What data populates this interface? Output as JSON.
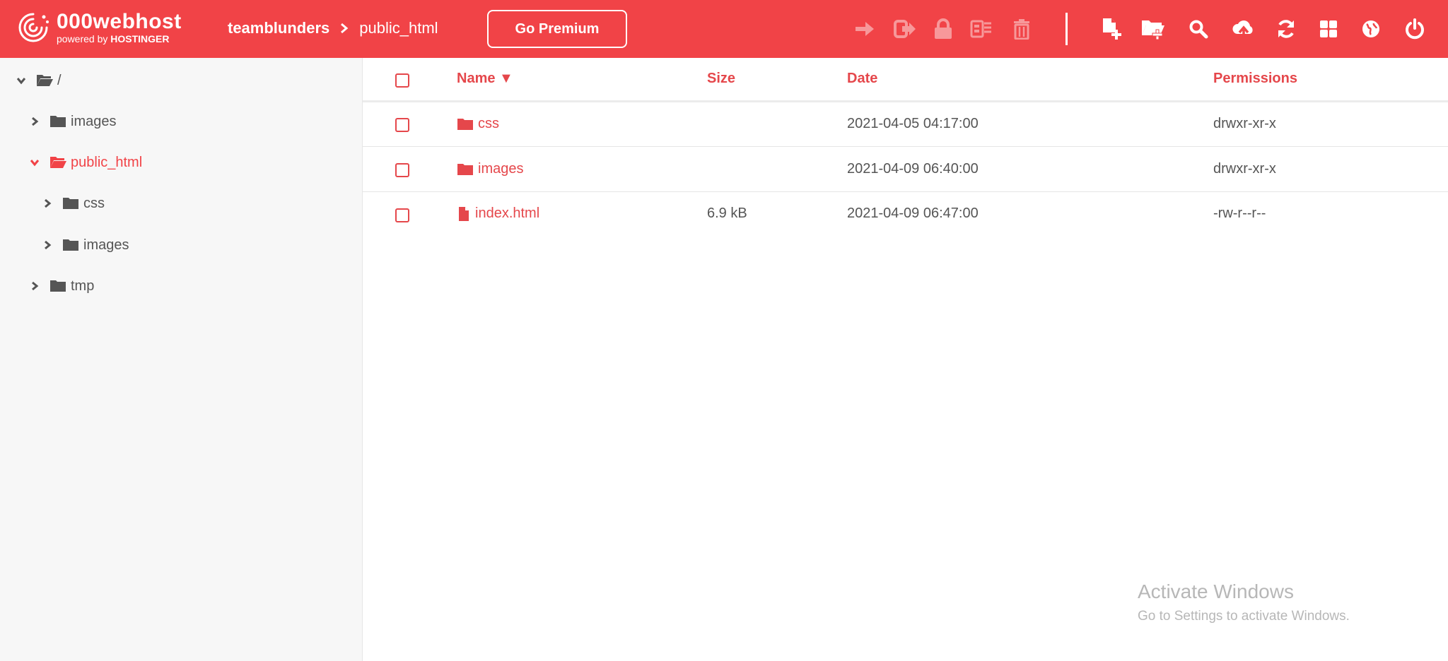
{
  "brand": {
    "name": "000webhost",
    "powered_prefix": "powered by ",
    "powered_brand": "HOSTINGER"
  },
  "breadcrumb": {
    "root": "teamblunders",
    "current": "public_html"
  },
  "premium_button": {
    "label": "Go Premium"
  },
  "toolbar": {
    "move": "arrow-right-icon",
    "rename": "sign-out-icon",
    "permissions": "lock-icon",
    "archive": "archive-icon",
    "delete": "trash-icon",
    "new_file": "new-file-icon",
    "new_folder": "new-folder-icon",
    "search": "search-icon",
    "upload": "cloud-upload-icon",
    "refresh": "refresh-icon",
    "view": "grid-view-icon",
    "website": "globe-icon",
    "logout": "power-icon"
  },
  "tree": [
    {
      "label": "/",
      "expanded": true,
      "active": false
    },
    {
      "label": "images",
      "expanded": false,
      "active": false
    },
    {
      "label": "public_html",
      "expanded": true,
      "active": true
    },
    {
      "label": "css",
      "expanded": false,
      "active": false
    },
    {
      "label": "images",
      "expanded": false,
      "active": false
    },
    {
      "label": "tmp",
      "expanded": false,
      "active": false
    }
  ],
  "table": {
    "columns": {
      "name": "Name ▼",
      "size": "Size",
      "date": "Date",
      "permissions": "Permissions"
    },
    "rows": [
      {
        "type": "folder",
        "name": "css",
        "size": "",
        "date": "2021-04-05 04:17:00",
        "permissions": "drwxr-xr-x"
      },
      {
        "type": "folder",
        "name": "images",
        "size": "",
        "date": "2021-04-09 06:40:00",
        "permissions": "drwxr-xr-x"
      },
      {
        "type": "file",
        "name": "index.html",
        "size": "6.9 kB",
        "date": "2021-04-09 06:47:00",
        "permissions": "-rw-r--r--"
      }
    ]
  },
  "watermark": {
    "title": "Activate Windows",
    "subtitle": "Go to Settings to activate Windows."
  },
  "colors": {
    "brand": "#f14347",
    "accent_text": "#e5474b"
  }
}
